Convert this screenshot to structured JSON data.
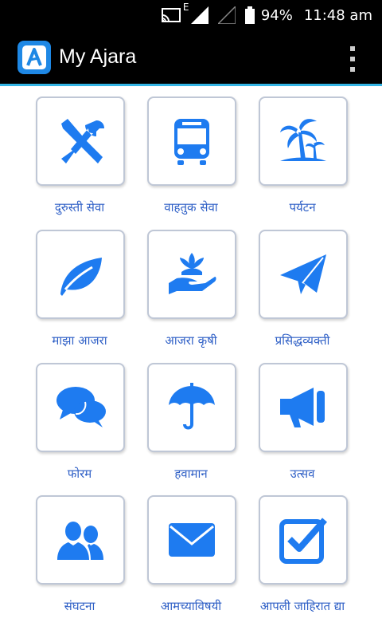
{
  "status_bar": {
    "network": "E",
    "battery": "94%",
    "time": "11:48 am"
  },
  "app_bar": {
    "title": "My Ajara",
    "logo_letter": "A"
  },
  "colors": {
    "accent": "#1e7bf0",
    "label": "#2e5fc6",
    "divider": "#33b5e5"
  },
  "tiles": [
    {
      "label": "दुरुस्ती सेवा",
      "icon": "tools-icon"
    },
    {
      "label": "वाहतुक सेवा",
      "icon": "bus-icon"
    },
    {
      "label": "पर्यटन",
      "icon": "palm-tree-icon"
    },
    {
      "label": "माझा आजरा",
      "icon": "leaf-icon"
    },
    {
      "label": "आजरा कृषी",
      "icon": "plant-hand-icon"
    },
    {
      "label": "प्रसिद्धव्यक्ती",
      "icon": "paper-plane-icon"
    },
    {
      "label": "फोरम",
      "icon": "chat-bubbles-icon"
    },
    {
      "label": "हवामान",
      "icon": "umbrella-icon"
    },
    {
      "label": "उत्सव",
      "icon": "megaphone-icon"
    },
    {
      "label": "संघटना",
      "icon": "people-icon"
    },
    {
      "label": "आमच्याविषयी",
      "icon": "envelope-icon"
    },
    {
      "label": "आपली जाहिरात द्या",
      "icon": "checkbox-icon"
    }
  ]
}
